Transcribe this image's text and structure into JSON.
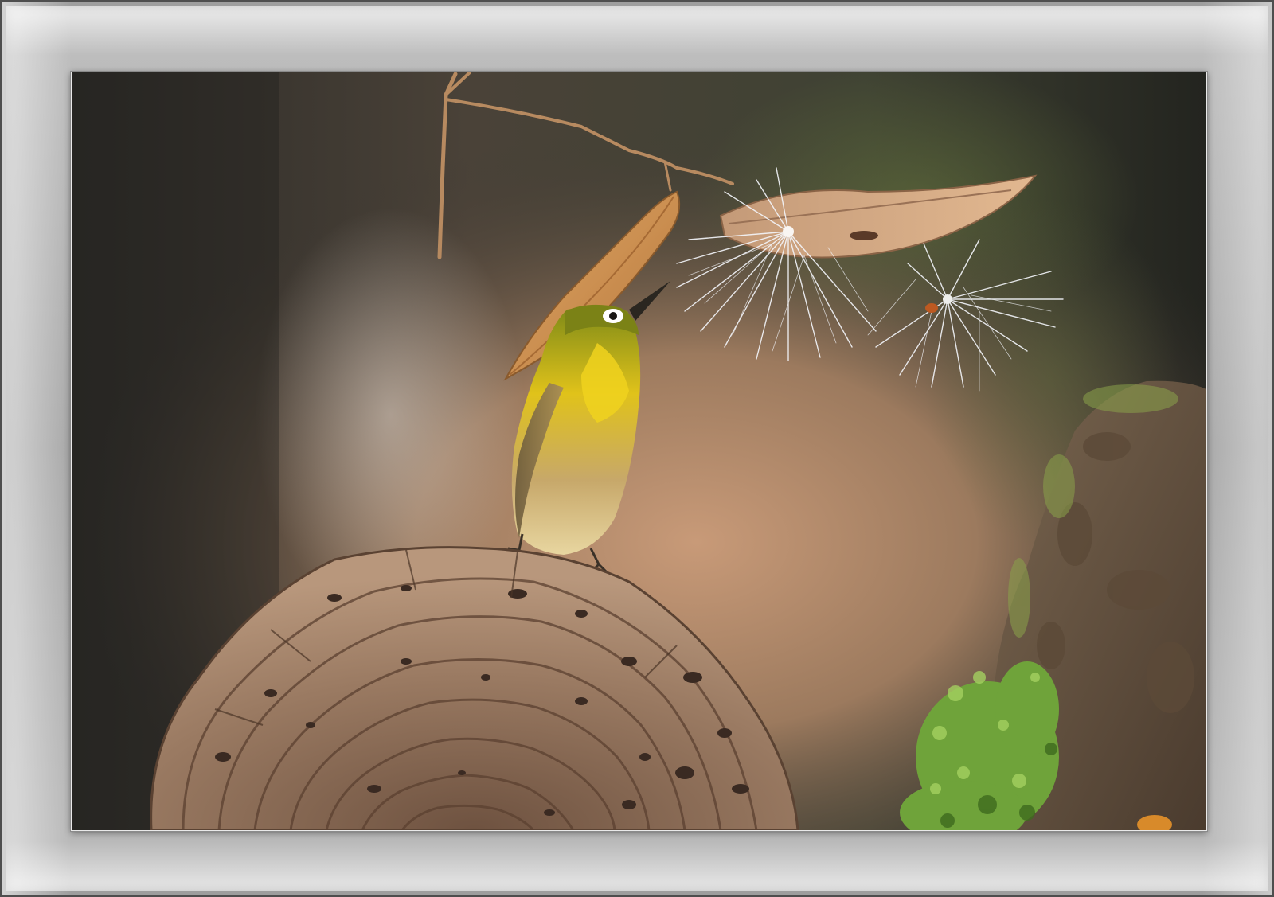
{
  "frame": {
    "style": "grey bevelled mat frame"
  },
  "photo": {
    "subject_icons": [
      "bird-icon",
      "leaf-icon",
      "seed-fluff-icon",
      "bracket-fungus-icon",
      "moss-rock-icon",
      "twig-icon"
    ]
  },
  "colors": {
    "frame_grey": "#a9a9a9",
    "background_dark": "#2b2926",
    "background_warm": "#b88a6a",
    "bird_yellow": "#d4b51a",
    "bird_olive": "#8a8a1c",
    "fungus_brown": "#8a6a52",
    "moss_green": "#6fa33a",
    "leaf_tan": "#c98a4e"
  }
}
